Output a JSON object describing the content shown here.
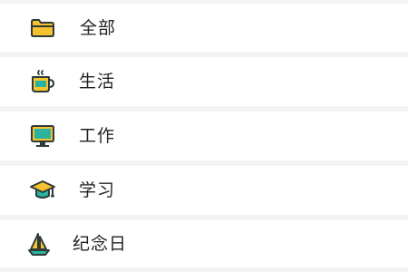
{
  "categories": [
    {
      "label": "全部",
      "icon": "folder-icon"
    },
    {
      "label": "生活",
      "icon": "mug-icon"
    },
    {
      "label": "工作",
      "icon": "monitor-icon"
    },
    {
      "label": "学习",
      "icon": "graduation-cap-icon"
    },
    {
      "label": "纪念日",
      "icon": "sailboat-icon"
    }
  ],
  "colors": {
    "background": "#f3f3f3",
    "row": "#ffffff",
    "text": "#222222",
    "icon_outline": "#2f3a3a",
    "yellow": "#f6c22f",
    "teal": "#2bb3a0"
  }
}
